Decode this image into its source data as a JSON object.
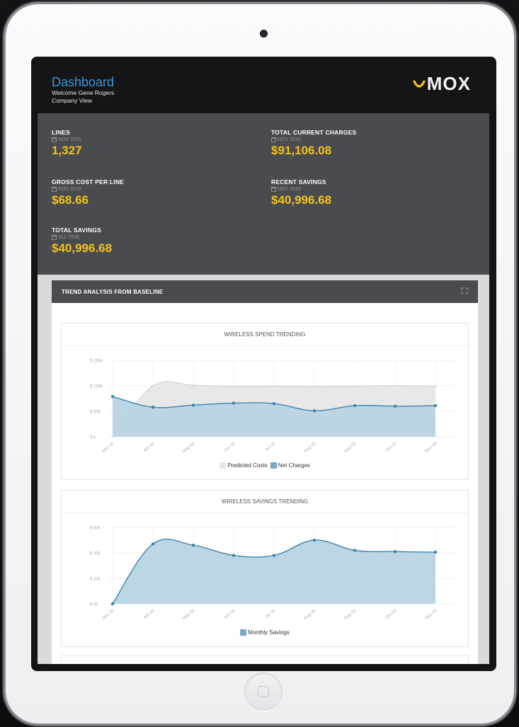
{
  "header": {
    "title": "Dashboard",
    "welcome": "Welcome Gene Rogers",
    "view": "Company View",
    "logo_text": "MOX",
    "logo_accent": "#f3c21b"
  },
  "stats": [
    {
      "label": "LINES",
      "period": "NOV 2016",
      "value": "1,327"
    },
    {
      "label": "TOTAL CURRENT CHARGES",
      "period": "NOV 2016",
      "value": "$91,106.08"
    },
    {
      "label": "GROSS COST PER LINE",
      "period": "NOV 2016",
      "value": "$68.66"
    },
    {
      "label": "RECENT SAVINGS",
      "period": "NOV 2016",
      "value": "$40,996.68"
    },
    {
      "label": "TOTAL SAVINGS",
      "period": "ALL TIME",
      "value": "$40,996.68"
    }
  ],
  "panel": {
    "title": "TREND ANALYSIS FROM BASELINE",
    "expand_icon": "expand-icon"
  },
  "chart_data": [
    {
      "type": "area",
      "title": "WIRELESS SPEND TRENDING",
      "categories": [
        "Mar-16",
        "Apr-16",
        "May-16",
        "Jun-16",
        "Jul-16",
        "Aug-16",
        "Sep-16",
        "Oct-16",
        "Nov-16"
      ],
      "yticks": [
        "$ k",
        "$ 50k",
        "$ 100k",
        "$ 150k"
      ],
      "ylim": [
        0,
        150000
      ],
      "series": [
        {
          "name": "Predicted Costs",
          "color": "#e6e6e6",
          "values": [
            0,
            100000,
            101000,
            99000,
            99500,
            98500,
            99500,
            100500,
            99500
          ]
        },
        {
          "name": "Net Charges",
          "color": "#b9d4e3",
          "values": [
            79000,
            58000,
            62000,
            66000,
            65000,
            51000,
            61000,
            60000,
            61000
          ]
        }
      ]
    },
    {
      "type": "area",
      "title": "WIRELESS SAVINGS TRENDING",
      "categories": [
        "Mar-16",
        "Apr-16",
        "May-16",
        "Jun-16",
        "Jul-16",
        "Aug-16",
        "Sep-16",
        "Oct-16",
        "Nov-16"
      ],
      "yticks": [
        "$ 0k",
        "$ 20k",
        "$ 40k",
        "$ 60k"
      ],
      "ylim": [
        0,
        60000
      ],
      "series": [
        {
          "name": "Monthly Savings",
          "color": "#b9d4e3",
          "values": [
            0,
            47000,
            46000,
            38000,
            38000,
            50000,
            42000,
            41000,
            40500
          ]
        }
      ]
    }
  ],
  "colors": {
    "line": "#3b84b1",
    "predicted_fill": "#e6e6e6",
    "predicted_line": "#cfcfcf",
    "savings_fill": "#b9d4e3"
  }
}
